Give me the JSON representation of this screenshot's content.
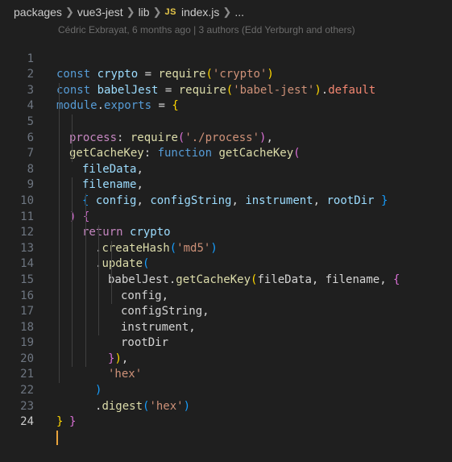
{
  "breadcrumb": {
    "segments": [
      "packages",
      "vue3-jest",
      "lib"
    ],
    "file_badge": "JS",
    "file_name": "index.js",
    "trailing": "..."
  },
  "blame": {
    "text": "Cédric Exbrayat, 6 months ago | 3 authors (Edd Yerburgh and others)"
  },
  "editor": {
    "active_line": 24,
    "lines": [
      {
        "n": "1"
      },
      {
        "n": "2"
      },
      {
        "n": "3"
      },
      {
        "n": "4"
      },
      {
        "n": "5"
      },
      {
        "n": "6"
      },
      {
        "n": "7"
      },
      {
        "n": "8"
      },
      {
        "n": "9"
      },
      {
        "n": "10"
      },
      {
        "n": "11"
      },
      {
        "n": "12"
      },
      {
        "n": "13"
      },
      {
        "n": "14"
      },
      {
        "n": "15"
      },
      {
        "n": "16"
      },
      {
        "n": "17"
      },
      {
        "n": "18"
      },
      {
        "n": "19"
      },
      {
        "n": "20"
      },
      {
        "n": "21"
      },
      {
        "n": "22"
      },
      {
        "n": "23"
      },
      {
        "n": "24"
      }
    ],
    "tokens": {
      "const": "const",
      "crypto": "crypto",
      "eq": " = ",
      "require": "require",
      "s_crypto": "'crypto'",
      "babelJest": "babelJest",
      "s_babeljest": "'babel-jest'",
      "default": "default",
      "module": "module",
      "exports": "exports",
      "process": "process",
      "s_process": "'./process'",
      "getCacheKey": "getCacheKey",
      "function": "function",
      "fileData": "fileData",
      "filename": "filename",
      "config": "config",
      "configString": "configString",
      "instrument": "instrument",
      "rootDir": "rootDir",
      "return": "return",
      "createHash": "createHash",
      "s_md5": "'md5'",
      "update": "update",
      "s_hex": "'hex'",
      "digest": "digest"
    }
  },
  "colors": {
    "background": "#1f1f1f",
    "keyword": "#569cd6",
    "control": "#c586c0",
    "variable": "#9cdcfe",
    "function": "#dcdcaa",
    "string": "#ce9178",
    "cursor": "#e8a33c"
  }
}
